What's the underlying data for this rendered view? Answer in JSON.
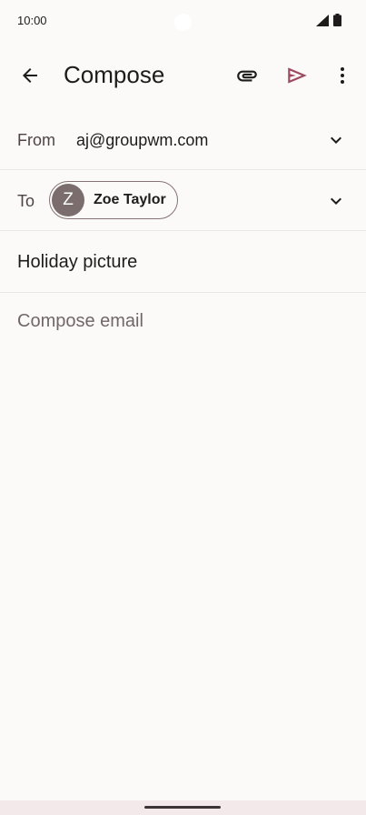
{
  "status_bar": {
    "time": "10:00",
    "icons": [
      "signal-icon",
      "battery-icon"
    ]
  },
  "app_bar": {
    "title": "Compose",
    "icons": [
      "arrow-back-icon",
      "paperclip-icon",
      "send-icon",
      "more-vert-icon"
    ],
    "send_color": "#9c4a5f"
  },
  "from": {
    "label": "From",
    "value": "aj@groupwm.com"
  },
  "to": {
    "label": "To",
    "recipients": [
      {
        "initial": "Z",
        "name": "Zoe Taylor"
      }
    ]
  },
  "subject": {
    "value": "Holiday picture"
  },
  "body": {
    "placeholder": "Compose email"
  }
}
